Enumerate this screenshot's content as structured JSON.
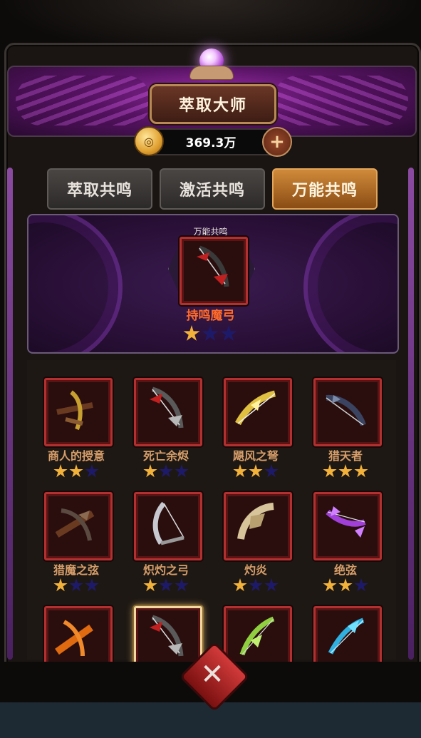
{
  "header": {
    "title": "萃取大师"
  },
  "currency": {
    "value": "369.3万",
    "coin_icon": "coin-icon",
    "plus_icon": "plus-icon"
  },
  "tabs": [
    {
      "label": "萃取共鸣",
      "active": false
    },
    {
      "label": "激活共鸣",
      "active": false
    },
    {
      "label": "万能共鸣",
      "active": true
    }
  ],
  "featured": {
    "section_label": "万能共鸣",
    "name": "持鸣魔弓",
    "stars": 1,
    "max_stars": 3
  },
  "items": [
    {
      "name": "商人的授意",
      "stars": 2,
      "icon": "crossbow-gold",
      "selected": false
    },
    {
      "name": "死亡余烬",
      "stars": 1,
      "icon": "bow-dark-red",
      "selected": false
    },
    {
      "name": "飓风之弩",
      "stars": 2,
      "icon": "bow-golden",
      "selected": false
    },
    {
      "name": "猎天者",
      "stars": 3,
      "icon": "bow-steel",
      "selected": false
    },
    {
      "name": "猎魔之弦",
      "stars": 1,
      "icon": "crossbow-wood",
      "selected": false
    },
    {
      "name": "炽灼之弓",
      "stars": 1,
      "icon": "bow-silver",
      "selected": false
    },
    {
      "name": "灼炎",
      "stars": 1,
      "icon": "bow-bone",
      "selected": false
    },
    {
      "name": "绝弦",
      "stars": 2,
      "icon": "bow-purple",
      "selected": false
    },
    {
      "name": "",
      "stars": 0,
      "icon": "crossbow-orange",
      "selected": false
    },
    {
      "name": "",
      "stars": 0,
      "icon": "bow-dark-red",
      "selected": true
    },
    {
      "name": "",
      "stars": 0,
      "icon": "bow-green",
      "selected": false
    },
    {
      "name": "",
      "stars": 0,
      "icon": "bow-cyan",
      "selected": false
    }
  ],
  "colors": {
    "accent": "#b23030",
    "tab_active": "#d08a3a",
    "name_text": "#d79e6a",
    "featured_name": "#ff6a2a",
    "star_on": "#f2b23a",
    "star_off": "#1e1a6a"
  }
}
